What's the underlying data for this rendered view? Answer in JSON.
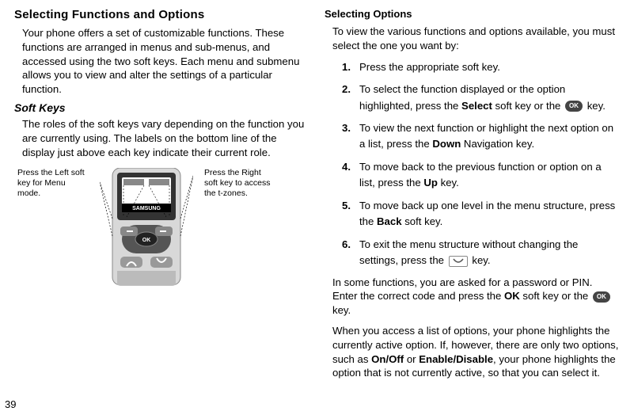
{
  "pageNumber": "39",
  "left": {
    "heading": "Selecting Functions and Options",
    "para1": "Your phone offers a set of customizable functions. These functions are arranged in menus and sub-menus, and accessed using the two soft keys. Each menu and submenu allows you to view and alter the settings of a particular function.",
    "subheading": "Soft Keys",
    "para2": "The roles of the soft keys vary depending on the function you are currently using. The labels on the bottom line of the display just above each key indicate their current role.",
    "captionLeft": "Press the Left soft key for Menu mode.",
    "captionRight": "Press the Right soft key to access the t-zones.",
    "phoneBrand": "SAMSUNG",
    "phoneOk": "OK"
  },
  "right": {
    "heading": "Selecting Options",
    "intro": "To view the various functions and options available, you must select the one you want by:",
    "items": [
      {
        "num": "1.",
        "pre": "Press the appropriate soft key.",
        "bold": "",
        "post": ""
      },
      {
        "num": "2.",
        "pre": "To select the function displayed or the option highlighted, press the ",
        "bold": "Select",
        "post": " soft key or the ",
        "icon": "ok",
        "tail": " key."
      },
      {
        "num": "3.",
        "pre": "To view the next function or highlight the next option on a list, press the ",
        "bold": "Down",
        "post": " Navigation key."
      },
      {
        "num": "4.",
        "pre": "To move back to the previous function or option on a list, press the ",
        "bold": "Up",
        "post": " key."
      },
      {
        "num": "5.",
        "pre": "To move back up one level in the menu structure, press the ",
        "bold": "Back",
        "post": " soft key."
      },
      {
        "num": "6.",
        "pre": "To exit the menu structure without changing the settings, press the ",
        "bold": "",
        "post": "",
        "icon": "end",
        "tail": " key."
      }
    ],
    "closing1_pre": "In some functions, you are asked for a password or PIN. Enter the correct code and press the ",
    "closing1_bold": "OK",
    "closing1_post": " soft key or the ",
    "closing1_tail": " key.",
    "closing2_pre": "When you access a list of options, your phone highlights the currently active option. If, however, there are only two options, such as ",
    "closing2_b1": "On/Off",
    "closing2_mid": " or ",
    "closing2_b2": "Enable/Disable",
    "closing2_post": ", your phone highlights the option that is not currently active, so that you can select it."
  },
  "icons": {
    "okText": "OK"
  }
}
